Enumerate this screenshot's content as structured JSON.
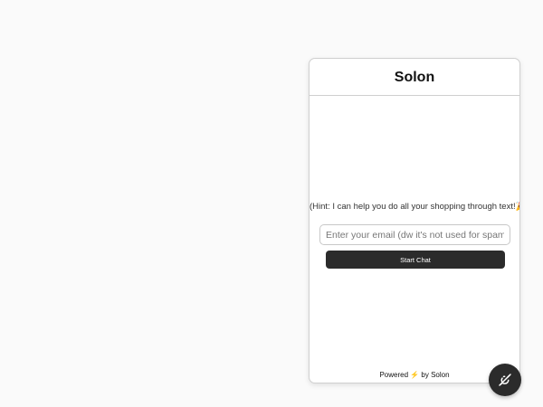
{
  "widget": {
    "title": "Solon",
    "hint": "(Hint: I can help you do all your shopping through text!🎉🎉)",
    "email": {
      "value": "",
      "placeholder": "Enter your email (dw it's not used for spam)"
    },
    "start_button_label": "Start Chat",
    "footer": {
      "prefix": "Powered ",
      "icon": "⚡",
      "suffix": " by Solon"
    }
  },
  "launcher": {
    "icon": "chat-off-icon"
  },
  "colors": {
    "page_background": "#fafafa",
    "button_background": "#2b2b2b",
    "bolt": "#f5b400"
  }
}
